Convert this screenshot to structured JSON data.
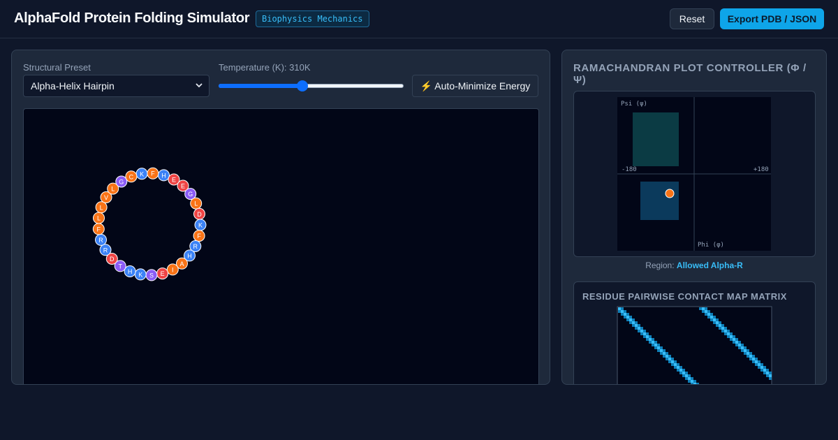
{
  "header": {
    "title": "AlphaFold Protein Folding Simulator",
    "badge": "Biophysics Mechanics",
    "reset_label": "Reset",
    "export_label": "Export PDB / JSON"
  },
  "controls": {
    "preset_label": "Structural Preset",
    "preset_value": "Alpha-Helix Hairpin",
    "temperature_label": "Temperature (K): 310K",
    "temperature_fraction": 0.45,
    "minimize_label": "⚡ Auto-Minimize Energy"
  },
  "chain": {
    "residues": [
      "K",
      "F",
      "H",
      "E",
      "E",
      "G",
      "L",
      "D",
      "K",
      "F",
      "R",
      "H",
      "A",
      "I",
      "E",
      "S",
      "K",
      "H",
      "T",
      "D",
      "R",
      "R",
      "F",
      "L",
      "L",
      "V",
      "L",
      "G",
      "C"
    ],
    "colors": {
      "blue": "#3b82f6",
      "orange": "#f97316",
      "red": "#ef4444",
      "purple": "#8b5cf6"
    },
    "color_keys": [
      "blue",
      "orange",
      "blue",
      "red",
      "red",
      "purple",
      "orange",
      "red",
      "blue",
      "orange",
      "blue",
      "blue",
      "orange",
      "orange",
      "red",
      "purple",
      "blue",
      "blue",
      "purple",
      "red",
      "blue",
      "blue",
      "orange",
      "orange",
      "orange",
      "orange",
      "orange",
      "purple",
      "orange"
    ]
  },
  "ramachandran": {
    "title": "RAMACHANDRAN PLOT CONTROLLER (Φ / Ψ)",
    "psi_label": "Psi (ψ)",
    "phi_label": "Phi (φ)",
    "tick_min": "-180",
    "tick_max": "+180",
    "region_prefix": "Region:",
    "region_value": "Allowed Alpha-R",
    "marker_color": "#f97316"
  },
  "contact_map": {
    "title": "RESIDUE PAIRWISE CONTACT MAP MATRIX"
  }
}
